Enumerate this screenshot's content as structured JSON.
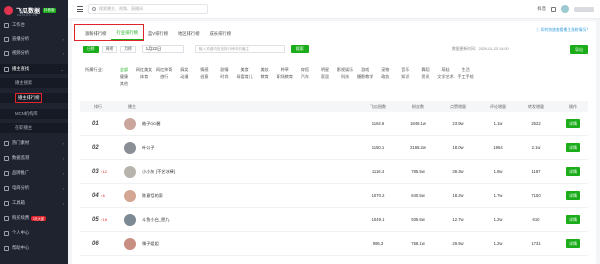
{
  "brand": {
    "name": "飞瓜数据",
    "badge": "抖音版",
    "tagline": "FEIGUA.CN",
    "color": "#e2344f"
  },
  "sidebar": {
    "items": [
      {
        "label": "工作台",
        "icon": "home-icon"
      },
      {
        "label": "直播分析",
        "icon": "live-icon",
        "caret": "›"
      },
      {
        "label": "视频分析",
        "icon": "video-icon",
        "caret": "›"
      },
      {
        "label": "播主查找",
        "icon": "user-search-icon",
        "caret": "⌄"
      },
      {
        "label": "热门素材",
        "icon": "fire-icon",
        "caret": "›"
      },
      {
        "label": "数据监测",
        "icon": "monitor-icon",
        "caret": "›"
      },
      {
        "label": "品牌推广",
        "icon": "brand-icon",
        "caret": "›"
      },
      {
        "label": "电商分析",
        "icon": "cart-icon",
        "caret": "›"
      },
      {
        "label": "工具箱",
        "icon": "toolbox-icon",
        "caret": "›"
      },
      {
        "label": "购买续费",
        "icon": "vip-icon",
        "badge": "3天大促"
      },
      {
        "label": "个人中心",
        "icon": "person-icon"
      },
      {
        "label": "帮助中心",
        "icon": "help-icon"
      }
    ],
    "sub_items": [
      {
        "label": "播主搜索"
      },
      {
        "label": "播主排行榜"
      },
      {
        "label": "MCN机构库"
      },
      {
        "label": "在职播主"
      }
    ]
  },
  "topbar": {
    "search_placeholder": "搜索播主、视频、直播间",
    "region": "抖音",
    "notice": "通知",
    "user": "抖音用户"
  },
  "tabs": [
    {
      "label": "涨粉排行榜"
    },
    {
      "label": "行业排行榜"
    },
    {
      "label": "蓝V排行榜"
    },
    {
      "label": "地区排行榜"
    },
    {
      "label": "成长排行榜"
    }
  ],
  "help_link": "ⓘ 如何快速查看播主涨粉情况？",
  "filters": {
    "periods": [
      "日榜",
      "周榜",
      "月榜"
    ],
    "date": "1月22日",
    "search_placeholder": "输入关键词查找排行榜中的播主",
    "search_button": "搜索",
    "update_time": "数据更新时间：2020-01-23 14:00",
    "export_button": "导出"
  },
  "categories": {
    "label": "所属行业：",
    "row1": [
      "全部",
      "网红美女",
      "网红帅哥",
      "搞笑",
      "情感",
      "剧情",
      "美食",
      "美妆",
      "种草",
      "穿搭",
      "明星",
      "影视娱乐",
      "游戏",
      "宠物",
      "音乐",
      "舞蹈",
      "萌娃",
      "生活"
    ],
    "row2": [
      "健康",
      "体育",
      "旅行",
      "动漫",
      "创意",
      "时尚",
      "母婴育儿",
      "教育",
      "职场教育",
      "汽车",
      "家居",
      "科技",
      "摄影教学",
      "政务",
      "知识",
      "资讯",
      "文学艺术",
      "手工手绘"
    ],
    "row3": [
      "其他"
    ]
  },
  "table": {
    "headers": [
      "排行",
      "播主",
      "飞瓜指数",
      "粉丝数",
      "点赞增量",
      "评论增量",
      "转发增量",
      "操作"
    ],
    "detail_label": "详情",
    "rows": [
      {
        "rank": "01",
        "delta": "",
        "name": "柚子cici酱",
        "index": "1164.6",
        "fans": "1848.1w",
        "likes": "23.9w",
        "comments": "1.1w",
        "shares": "2522",
        "avatar_color": "#c9a59b"
      },
      {
        "rank": "02",
        "delta": "",
        "name": "叶公子",
        "index": "1150.1",
        "fans": "2168.2w",
        "likes": "18.0w",
        "comments": "1954",
        "shares": "2.1w",
        "avatar_color": "#8a8f96"
      },
      {
        "rank": "03",
        "delta": "↑12",
        "name": "小小灰 (不艺冰棒)",
        "index": "1116.4",
        "fans": "785.5w",
        "likes": "39.3w",
        "comments": "1.8w",
        "shares": "1187",
        "avatar_color": "#b7b3ad"
      },
      {
        "rank": "04",
        "delta": "↑6",
        "name": "陈意恬的家",
        "index": "1070.2",
        "fans": "640.5w",
        "likes": "18.2w",
        "comments": "1.7w",
        "shares": "7150",
        "avatar_color": "#d3a593"
      },
      {
        "rank": "05",
        "delta": "↑18",
        "name": "斗鱼小白_肥九",
        "index": "1049.1",
        "fans": "935.6w",
        "likes": "12.7w",
        "comments": "1.2w",
        "shares": "610",
        "avatar_color": "#7e8a93"
      },
      {
        "rank": "06",
        "delta": "",
        "name": "噗子姐姐",
        "index": "995.3",
        "fans": "758.1w",
        "likes": "29.5w",
        "comments": "1.2w",
        "shares": "1731",
        "avatar_color": "#c98e82"
      }
    ]
  }
}
